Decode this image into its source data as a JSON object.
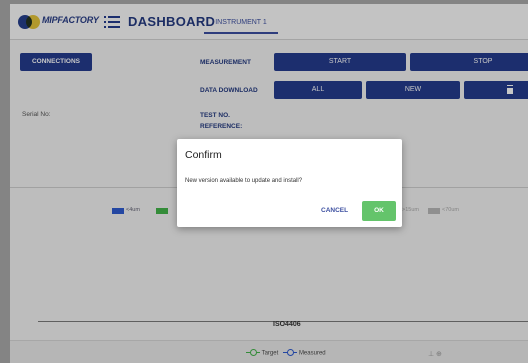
{
  "header": {
    "logo_text": "MIPFACTORY",
    "title": "DASHBOARD",
    "tab": "INSTRUMENT 1"
  },
  "controls": {
    "connections_label": "CONNECTIONS",
    "measurement_label": "MEASUREMENT",
    "start_label": "START",
    "stop_label": "STOP",
    "data_download_label": "DATA DOWNLOAD",
    "all_label": "ALL",
    "new_label": "NEW",
    "serial_label": "Serial No:",
    "test_no_label": "TEST NO.",
    "reference_label": "REFERENCE:"
  },
  "chart": {
    "legend_top": [
      "<4um",
      ">15um",
      "<70um"
    ],
    "axis_label": "ISO4406",
    "legend_bottom": [
      "Target",
      "Measured"
    ]
  },
  "dialog": {
    "title": "Confirm",
    "message": "New version available to update and install?",
    "cancel_label": "CANCEL",
    "ok_label": "OK"
  },
  "colors": {
    "primary": "#243c8e",
    "ok_button": "#64c46b",
    "overlay": "rgba(0,0,0,0.22)"
  },
  "icons": [
    "menu-icon",
    "trash-icon",
    "zoom-icon"
  ]
}
